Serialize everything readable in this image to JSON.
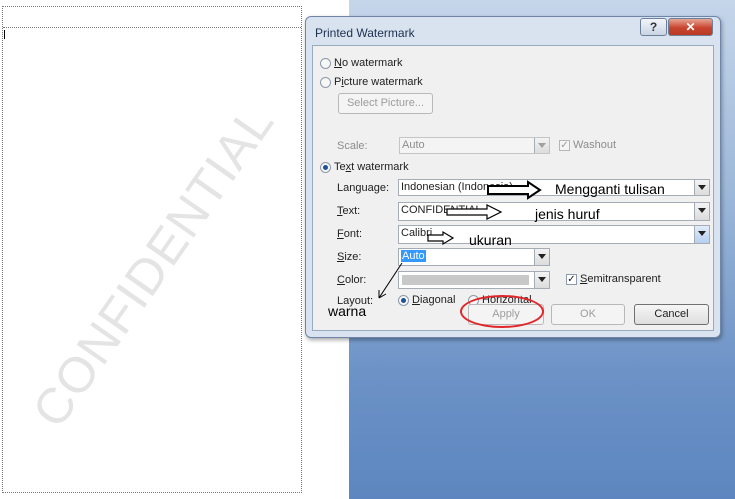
{
  "document": {
    "watermark_text": "CONFIDENTIAL"
  },
  "dialog": {
    "title": "Printed Watermark",
    "help_glyph": "?",
    "close_glyph": "✕",
    "no_watermark": {
      "accel": "N",
      "rest": "o watermark",
      "selected": false
    },
    "picture_watermark": {
      "pre": "P",
      "accel": "i",
      "rest": "cture watermark",
      "selected": false
    },
    "select_picture_label": "Select Picture...",
    "scale_label": "Scale:",
    "scale_value": "Auto",
    "washout": {
      "label": "Washout",
      "checked": true,
      "enabled": false
    },
    "text_watermark": {
      "pre": "Te",
      "accel": "x",
      "rest": "t watermark",
      "selected": true
    },
    "language": {
      "pre": "Lan",
      "accel": "g",
      "rest": "uage:",
      "value": "Indonesian (Indonesia)"
    },
    "text": {
      "accel": "T",
      "rest": "ext:",
      "value": "CONFIDENTIAL"
    },
    "font": {
      "accel": "F",
      "rest": "ont:",
      "value": "Calibri"
    },
    "size": {
      "accel": "S",
      "rest": "ize:",
      "value": "Auto"
    },
    "color": {
      "accel": "C",
      "rest": "olor:",
      "value_hex": "#c8c8c8"
    },
    "semitransparent": {
      "accel": "S",
      "rest": "emitransparent",
      "checked": true
    },
    "layout_label": "Layout:",
    "diagonal": {
      "accel": "D",
      "rest": "iagonal",
      "selected": true
    },
    "horizontal": {
      "accel": "H",
      "rest": "orizontal",
      "selected": false
    },
    "apply_label": "Apply",
    "ok_label": "OK",
    "cancel_label": "Cancel"
  },
  "annotations": {
    "text_note": "Mengganti tulisan",
    "font_note": "jenis huruf",
    "size_note": "ukuran",
    "color_note": "warna",
    "ellipse_color": "#e0262a"
  }
}
